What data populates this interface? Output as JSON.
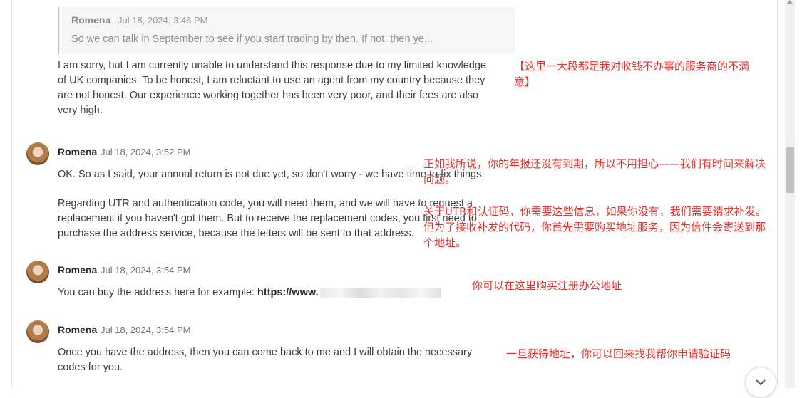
{
  "quote": {
    "author": "Romena",
    "date": "Jul 18, 2024, 3:46 PM",
    "text": "So we can talk in September to see if you start trading by then. If not, then ye..."
  },
  "reply": {
    "lines": [
      "I am sorry, but I am currently unable to understand this response due to my limited knowledge",
      "of UK companies. To be honest, I am reluctant to use an agent from my country because they",
      "are not honest. Our experience working together has been very poor, and their fees are also",
      "very high."
    ]
  },
  "messages": [
    {
      "author": "Romena",
      "date": "Jul 18, 2024, 3:52 PM",
      "p1": "OK. So as I said, your annual return is not due yet, so don't worry - we have time to fix things.",
      "p2_lines": [
        "Regarding UTR and authentication code, you will need them, and we will have to request a",
        "replacement if you haven't got them. But to receive the replacement codes, you first need to",
        "purchase the address service, because the letters will be sent to that address."
      ]
    },
    {
      "author": "Romena",
      "date": "Jul 18, 2024, 3:54 PM",
      "text": "You can buy the address here for example: ",
      "link": "https://www."
    },
    {
      "author": "Romena",
      "date": "Jul 18, 2024, 3:54 PM",
      "lines": [
        "Once you have the address, then you can come back to me and I will obtain the necessary",
        "codes for you."
      ]
    }
  ],
  "annotations": {
    "note1_lines": [
      "【这里一大段都是我对收钱不办事的服务商的不满",
      "意】"
    ],
    "note2_lines": [
      "正如我所说，你的年报还没有到期，所以不用担心——我们有时间来解决",
      "问题。"
    ],
    "note3_lines": [
      "关于UTR和认证码，你需要这些信息，如果你没有，我们需要请求补发。",
      "但为了接收补发的代码，你首先需要购买地址服务，因为信件会寄送到那",
      "个地址。"
    ],
    "note4": "你可以在这里购买注册办公地址",
    "note5": "一旦获得地址，你可以回来找我帮你申请验证码"
  },
  "icons": {
    "scroll_button": "chevron-down-icon"
  },
  "colors": {
    "annotation": "#e0332e",
    "quote_bg": "#f6f6f6"
  }
}
